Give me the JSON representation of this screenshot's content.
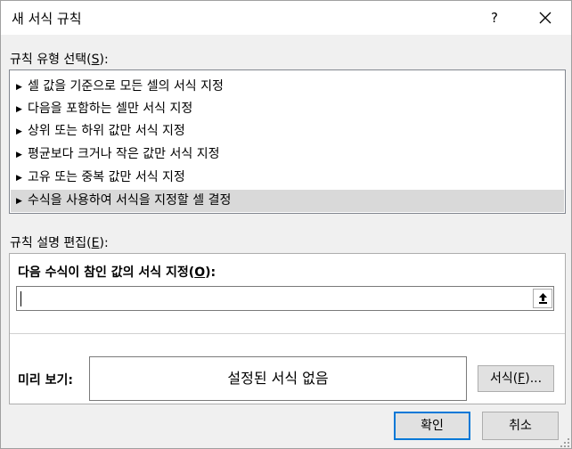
{
  "dialog": {
    "title": "새 서식 규칙",
    "help_label": "?"
  },
  "rule_type": {
    "label_text": "규칙 유형 선택(",
    "label_key": "S",
    "label_end": "):",
    "items": [
      {
        "label": "셀 값을 기준으로 모든 셀의 서식 지정",
        "selected": false
      },
      {
        "label": "다음을 포함하는 셀만 서식 지정",
        "selected": false
      },
      {
        "label": "상위 또는 하위 값만 서식 지정",
        "selected": false
      },
      {
        "label": "평균보다 크거나 작은 값만 서식 지정",
        "selected": false
      },
      {
        "label": "고유 또는 중복 값만 서식 지정",
        "selected": false
      },
      {
        "label": "수식을 사용하여 서식을 지정할 셀 결정",
        "selected": true
      }
    ]
  },
  "description": {
    "label_text": "규칙 설명 편집(",
    "label_key": "E",
    "label_end": "):",
    "formula_label_text": "다음 수식이 참인 값의 서식 지정(",
    "formula_label_key": "O",
    "formula_label_end": "):",
    "formula_value": "",
    "preview_label": "미리 보기:",
    "preview_text": "설정된 서식 없음",
    "format_button_text": "서식(",
    "format_button_key": "F",
    "format_button_end": ")..."
  },
  "buttons": {
    "ok": "확인",
    "cancel": "취소"
  },
  "icons": {
    "close": "close-icon",
    "collapse": "collapse-dialog-icon",
    "expand_triangle": "triangle-right-icon",
    "resize_grip": "resize-grip-icon"
  }
}
